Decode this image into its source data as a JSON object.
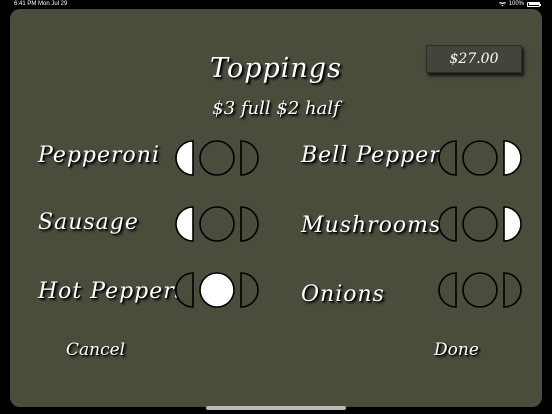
{
  "status_bar": {
    "time": "6:41 PM",
    "date": "Mon Jul 29",
    "battery": "100%",
    "wifi_icon": "wifi-icon",
    "battery_icon": "battery-icon"
  },
  "header": {
    "title": "Toppings",
    "subtitle": "$3 full $2 half"
  },
  "price": "$27.00",
  "toppings": [
    {
      "label": "Pepperoni",
      "selection": "left"
    },
    {
      "label": "Sausage",
      "selection": "left"
    },
    {
      "label": "Hot Peppers",
      "selection": "full"
    },
    {
      "label": "Bell Peppers",
      "selection": "right"
    },
    {
      "label": "Mushrooms",
      "selection": "right"
    },
    {
      "label": "Onions",
      "selection": "none"
    }
  ],
  "actions": {
    "cancel": "Cancel",
    "done": "Done"
  },
  "colors": {
    "panel": "#4a4d3b",
    "selected_fill": "#ffffff",
    "unselected_fill": "#4a4d3b",
    "stroke": "#000000"
  }
}
